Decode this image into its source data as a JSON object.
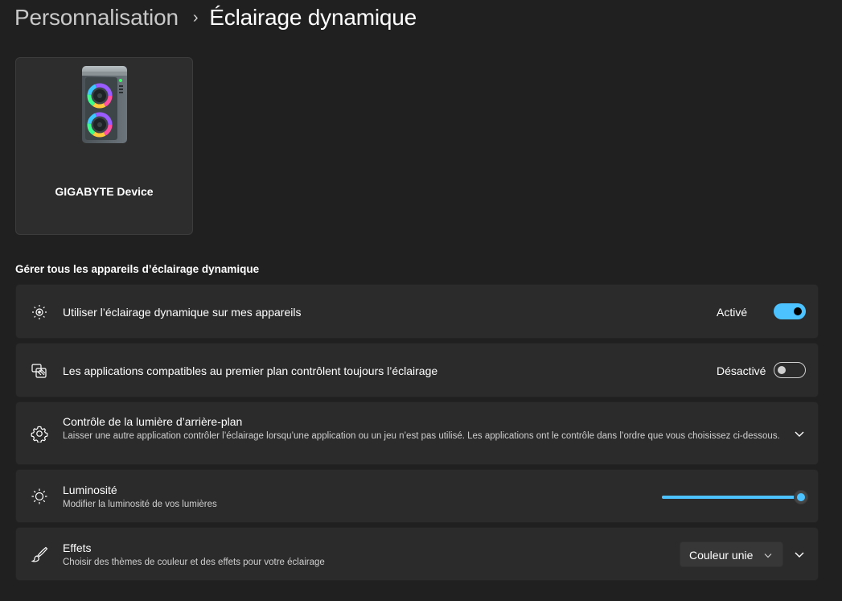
{
  "breadcrumb": {
    "parent": "Personnalisation",
    "separator": "›",
    "current": "Éclairage dynamique"
  },
  "device": {
    "name": "GIGABYTE Device",
    "icon": "pc-tower-rgb-icon"
  },
  "section": {
    "heading": "Gérer tous les appareils d’éclairage dynamique"
  },
  "rows": {
    "use_dynamic": {
      "icon": "dynamic-lighting-icon",
      "title": "Utiliser l’éclairage dynamique sur mes appareils",
      "state": "Activé",
      "enabled": true
    },
    "foreground_apps": {
      "icon": "apps-lighting-icon",
      "title": "Les applications compatibles au premier plan contrôlent toujours l’éclairage",
      "state": "Désactivé",
      "enabled": false
    },
    "background_control": {
      "icon": "gear-icon",
      "title": "Contrôle de la lumière d’arrière-plan",
      "description": "Laisser une autre application contrôler l’éclairage lorsqu’une application ou un jeu n’est pas utilisé. Les applications ont le contrôle dans l’ordre que vous choisissez ci-dessous."
    },
    "brightness": {
      "icon": "sun-icon",
      "title": "Luminosité",
      "description": "Modifier la luminosité de vos lumières",
      "value_percent": 100
    },
    "effects": {
      "icon": "paintbrush-icon",
      "title": "Effets",
      "description": "Choisir des thèmes de couleur et des effets pour votre éclairage",
      "selected": "Couleur unie"
    }
  },
  "colors": {
    "accent": "#4cc2ff",
    "background": "#202020",
    "card": "#2b2b2b"
  }
}
